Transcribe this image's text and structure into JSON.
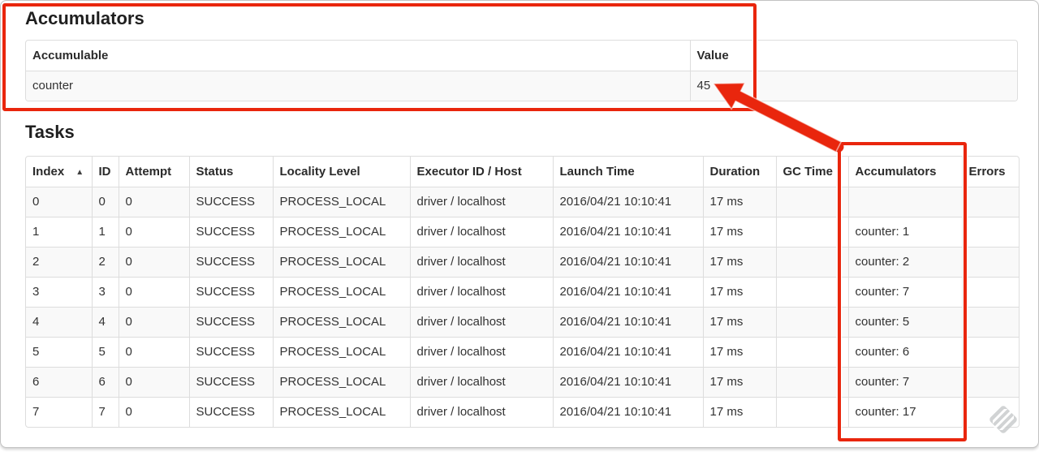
{
  "annotation": {
    "color": "#e9260d"
  },
  "accumulators": {
    "title": "Accumulators",
    "headers": [
      "Accumulable",
      "Value"
    ],
    "rows": [
      [
        "counter",
        "45"
      ]
    ]
  },
  "tasks": {
    "title": "Tasks",
    "sort_icon": "▲",
    "headers": [
      "Index",
      "ID",
      "Attempt",
      "Status",
      "Locality Level",
      "Executor ID / Host",
      "Launch Time",
      "Duration",
      "GC Time",
      "Accumulators",
      "Errors"
    ],
    "rows": [
      [
        "0",
        "0",
        "0",
        "SUCCESS",
        "PROCESS_LOCAL",
        "driver / localhost",
        "2016/04/21 10:10:41",
        "17 ms",
        "",
        "",
        ""
      ],
      [
        "1",
        "1",
        "0",
        "SUCCESS",
        "PROCESS_LOCAL",
        "driver / localhost",
        "2016/04/21 10:10:41",
        "17 ms",
        "",
        "counter: 1",
        ""
      ],
      [
        "2",
        "2",
        "0",
        "SUCCESS",
        "PROCESS_LOCAL",
        "driver / localhost",
        "2016/04/21 10:10:41",
        "17 ms",
        "",
        "counter: 2",
        ""
      ],
      [
        "3",
        "3",
        "0",
        "SUCCESS",
        "PROCESS_LOCAL",
        "driver / localhost",
        "2016/04/21 10:10:41",
        "17 ms",
        "",
        "counter: 7",
        ""
      ],
      [
        "4",
        "4",
        "0",
        "SUCCESS",
        "PROCESS_LOCAL",
        "driver / localhost",
        "2016/04/21 10:10:41",
        "17 ms",
        "",
        "counter: 5",
        ""
      ],
      [
        "5",
        "5",
        "0",
        "SUCCESS",
        "PROCESS_LOCAL",
        "driver / localhost",
        "2016/04/21 10:10:41",
        "17 ms",
        "",
        "counter: 6",
        ""
      ],
      [
        "6",
        "6",
        "0",
        "SUCCESS",
        "PROCESS_LOCAL",
        "driver / localhost",
        "2016/04/21 10:10:41",
        "17 ms",
        "",
        "counter: 7",
        ""
      ],
      [
        "7",
        "7",
        "0",
        "SUCCESS",
        "PROCESS_LOCAL",
        "driver / localhost",
        "2016/04/21 10:10:41",
        "17 ms",
        "",
        "counter: 17",
        ""
      ]
    ]
  }
}
